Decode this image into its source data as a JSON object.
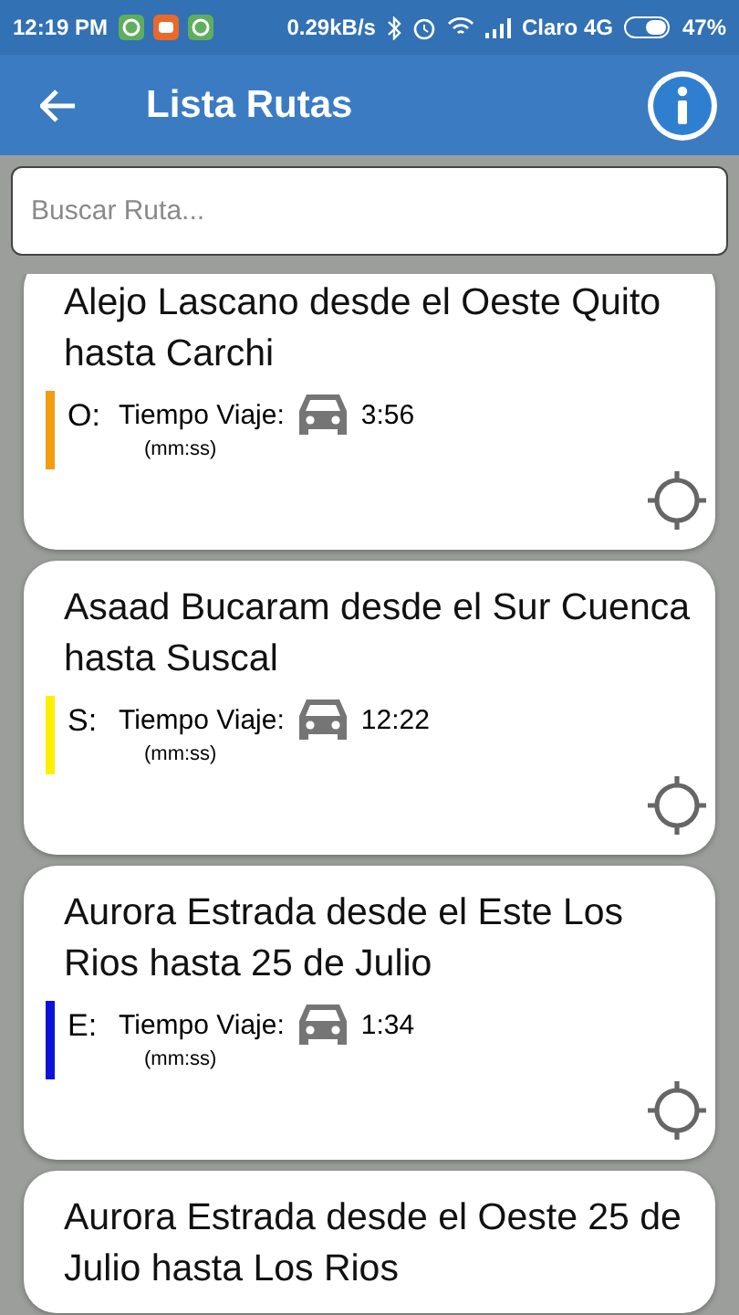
{
  "status_bar": {
    "time": "12:19 PM",
    "speed": "0.29kB/s",
    "carrier": "Claro 4G",
    "battery": "47%"
  },
  "app_bar": {
    "title": "Lista Rutas"
  },
  "search": {
    "placeholder": "Buscar Ruta..."
  },
  "routes": [
    {
      "title": "Alejo Lascano desde el Oeste Quito hasta Carchi",
      "code": "O:",
      "color": "#f39c12",
      "time_label": "Tiempo Viaje:",
      "time": "3:56",
      "unit": "(mm:ss)"
    },
    {
      "title": "Asaad Bucaram desde el Sur Cuenca hasta Suscal",
      "code": "S:",
      "color": "#ffee00",
      "time_label": "Tiempo Viaje:",
      "time": "12:22",
      "unit": "(mm:ss)"
    },
    {
      "title": "Aurora Estrada desde el Este  Los Rios hasta 25 de Julio",
      "code": "E:",
      "color": "#0a14d8",
      "time_label": "Tiempo Viaje:",
      "time": "1:34",
      "unit": "(mm:ss)"
    },
    {
      "title": "Aurora Estrada desde el Oeste  25 de Julio hasta Los Rios"
    }
  ]
}
